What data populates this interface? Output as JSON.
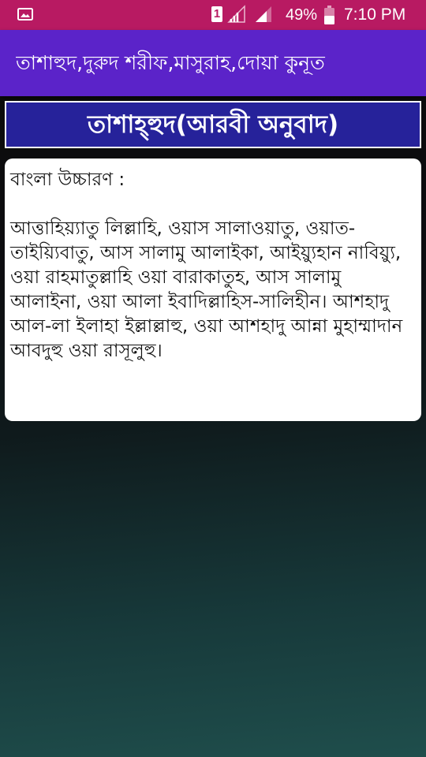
{
  "status_bar": {
    "sim_slot": "1",
    "battery_percent": "49%",
    "time": "7:10 PM",
    "icons": [
      "gallery-icon",
      "signal-icon",
      "signal-icon",
      "battery-icon"
    ]
  },
  "app_bar": {
    "title": "তাশাহুদ,দুরুদ শরীফ,মাসুরাহ,দোয়া কুনূত"
  },
  "section": {
    "title": "তাশাহ্হুদ(আরবী অনুবাদ)"
  },
  "content": {
    "label": "বাংলা উচ্চারণ :",
    "body": "আত্তাহিয়্যাতু লিল্লাহি, ওয়াস সালাওয়াতু, ওয়াত- তাইয়্যিবাতু, আস সালামু আলাইকা, আইয়্যুহান নাবিয়্যু, ওয়া রাহমাতুল্লাহি ওয়া বারাকাতুহ, আস সালামু আলাইনা, ওয়া আলা ইবাদিল্লাহিস-সালিহীন। আশহাদু আল-লা ইলাহা ইল্লাল্লাহু, ওয়া আশহাদু আন্না মুহাম্মাদান আবদুহু ওয়া রাসূলুহু।"
  },
  "colors": {
    "status_bar": "#b81a62",
    "app_bar": "#5b23c9",
    "section_header": "#26229a",
    "card": "#ffffff"
  }
}
